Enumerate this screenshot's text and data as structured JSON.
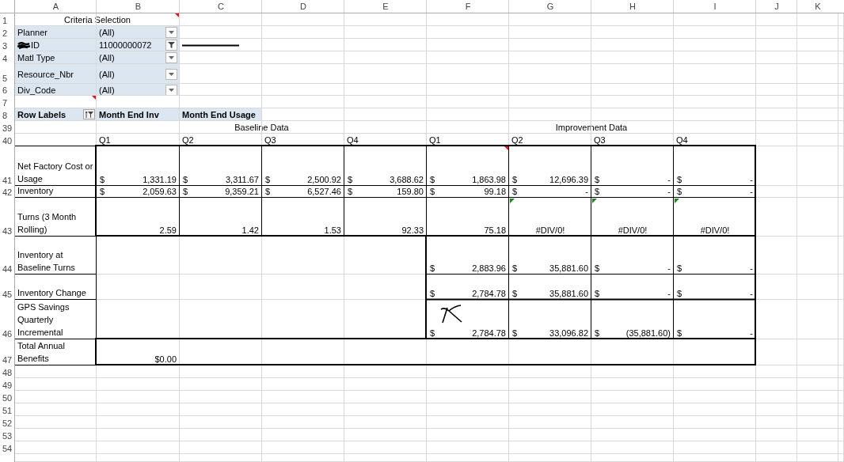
{
  "column_headers": [
    "A",
    "B",
    "C",
    "D",
    "E",
    "F",
    "G",
    "H",
    "I",
    "J",
    "K"
  ],
  "row_numbers": [
    "1",
    "2",
    "3",
    "4",
    "5",
    "6",
    "7",
    "8",
    "39",
    "40",
    "41",
    "42",
    "43",
    "44",
    "45",
    "46",
    "47",
    "48",
    "49",
    "50",
    "51",
    "52",
    "53",
    "54"
  ],
  "criteria": {
    "title": "Criteria Selection",
    "comment": true,
    "end_comment": true,
    "fields": [
      {
        "label": "Planner",
        "value": "(All)",
        "filtered": false,
        "redacted": false
      },
      {
        "label": "ID",
        "value": "11000000072",
        "filtered": true,
        "redacted": true
      },
      {
        "label": "Matl Type",
        "value": "(All)",
        "filtered": false,
        "redacted": false
      },
      {
        "label": "Resource_Nbr",
        "value": "(All)",
        "filtered": false,
        "redacted": false
      },
      {
        "label": "Div_Code",
        "value": "(All)",
        "filtered": false,
        "redacted": false
      }
    ]
  },
  "pivot_header": {
    "row_labels": "Row Labels",
    "values": [
      "Month End Inv",
      "Month End Usage"
    ]
  },
  "baseline": {
    "title": "Baseline Data",
    "quarters": [
      "Q1",
      "Q2",
      "Q3",
      "Q4"
    ]
  },
  "improvement": {
    "title": "Improvement Data",
    "quarters": [
      "Q1",
      "Q2",
      "Q3",
      "Q4"
    ]
  },
  "metrics": [
    {
      "label": "Net Factory Cost or Usage",
      "kind": "detail",
      "baseline": [
        {
          "symbol": "$",
          "amount": "1,331.19"
        },
        {
          "symbol": "$",
          "amount": "3,311.67"
        },
        {
          "symbol": "$",
          "amount": "2,500.92"
        },
        {
          "symbol": "$",
          "amount": "3,688.62"
        }
      ],
      "improvement": [
        {
          "symbol": "$",
          "amount": "1,863.98",
          "comment": true
        },
        {
          "symbol": "$",
          "amount": "12,696.39",
          "comment": false
        },
        {
          "symbol": "$",
          "amount": "-",
          "comment": false
        },
        {
          "symbol": "$",
          "amount": "-",
          "comment": false
        }
      ]
    },
    {
      "label": "Inventory",
      "kind": "detail",
      "baseline": [
        {
          "symbol": "$",
          "amount": "2,059.63"
        },
        {
          "symbol": "$",
          "amount": "9,359.21"
        },
        {
          "symbol": "$",
          "amount": "6,527.46"
        },
        {
          "symbol": "$",
          "amount": "159.80"
        }
      ],
      "improvement": [
        {
          "symbol": "$",
          "amount": "99.18"
        },
        {
          "symbol": "$",
          "amount": "-"
        },
        {
          "symbol": "$",
          "amount": "-"
        },
        {
          "symbol": "$",
          "amount": "-"
        }
      ]
    },
    {
      "label": "Turns (3 Month Rolling)",
      "kind": "detail",
      "baseline": [
        {
          "amount": "2.59"
        },
        {
          "amount": "1.42"
        },
        {
          "amount": "1.53"
        },
        {
          "amount": "92.33"
        }
      ],
      "improvement": [
        {
          "amount": "75.18",
          "flagged": false
        },
        {
          "amount": "#DIV/0!",
          "kind": "error",
          "flagged": true
        },
        {
          "amount": "#DIV/0!",
          "kind": "error",
          "flagged": true
        },
        {
          "amount": "#DIV/0!",
          "kind": "error",
          "flagged": true
        }
      ]
    },
    {
      "label": "Inventory at Baseline Turns",
      "kind": "detail",
      "improvement": [
        {
          "symbol": "$",
          "amount": "2,883.96"
        },
        {
          "symbol": "$",
          "amount": "35,881.60"
        },
        {
          "symbol": "$",
          "amount": "-"
        },
        {
          "symbol": "$",
          "amount": "-"
        }
      ]
    },
    {
      "label": "Inventory Change",
      "kind": "detail",
      "improvement": [
        {
          "symbol": "$",
          "amount": "2,784.78"
        },
        {
          "symbol": "$",
          "amount": "35,881.60"
        },
        {
          "symbol": "$",
          "amount": "-"
        },
        {
          "symbol": "$",
          "amount": "-"
        }
      ]
    },
    {
      "label": "GPS Savings Quarterly Incremental",
      "kind": "detail",
      "improvement": [
        {
          "symbol": "$",
          "amount": "2,784.78"
        },
        {
          "symbol": "$",
          "amount": "33,096.82"
        },
        {
          "symbol": "$",
          "amount": "(35,881.60)"
        },
        {
          "symbol": "$",
          "amount": "-"
        }
      ]
    },
    {
      "label": "Total Annual Benefits",
      "kind": "total",
      "baseline": [
        {
          "amount": "$0.00"
        }
      ]
    }
  ]
}
